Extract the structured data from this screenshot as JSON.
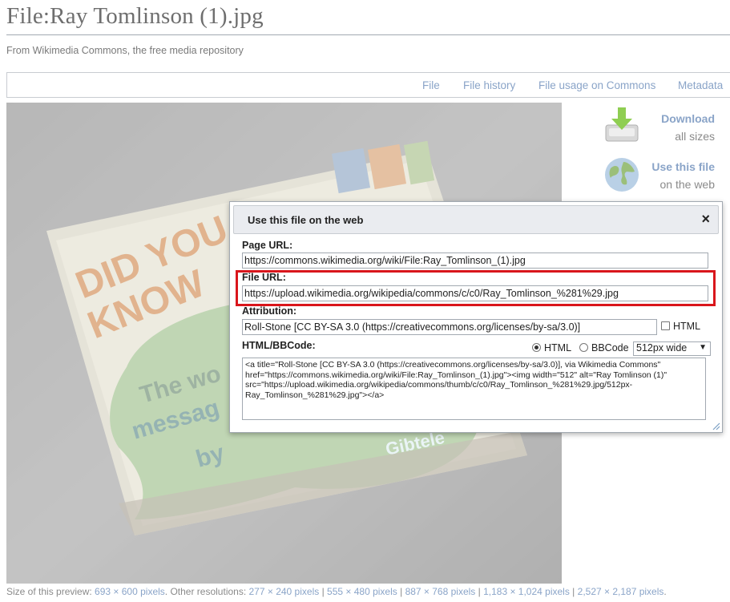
{
  "page": {
    "title": "File:Ray Tomlinson (1).jpg",
    "tagline": "From Wikimedia Commons, the free media repository"
  },
  "tabs": [
    {
      "label": "File"
    },
    {
      "label": "File history"
    },
    {
      "label": "File usage on Commons"
    },
    {
      "label": "Metadata"
    }
  ],
  "sidebar": {
    "download": {
      "label": "Download",
      "sub": "all sizes",
      "icon": "download-icon"
    },
    "use": {
      "label": "Use this file",
      "sub": "on the web",
      "icon": "globe-icon"
    }
  },
  "dialog": {
    "title": "Use this file on the web",
    "close": "×",
    "page_url_label": "Page URL:",
    "page_url": "https://commons.wikimedia.org/wiki/File:Ray_Tomlinson_(1).jpg",
    "file_url_label": "File URL:",
    "file_url": "https://upload.wikimedia.org/wikipedia/commons/c/c0/Ray_Tomlinson_%281%29.jpg",
    "attribution_label": "Attribution:",
    "attribution": "Roll-Stone [CC BY-SA 3.0 (https://creativecommons.org/licenses/by-sa/3.0)]",
    "attribution_html_label": "HTML",
    "code_label": "HTML/BBCode:",
    "radio_html": "HTML",
    "radio_bbcode": "BBCode",
    "size_select": "512px wide",
    "code": "<a title=\"Roll-Stone [CC BY-SA 3.0 (https://creativecommons.org/licenses/by-sa/3.0)], via Wikimedia Commons\" href=\"https://commons.wikimedia.org/wiki/File:Ray_Tomlinson_(1).jpg\"><img width=\"512\" alt=\"Ray Tomlinson (1)\" src=\"https://upload.wikimedia.org/wikipedia/commons/thumb/c/c0/Ray_Tomlinson_%281%29.jpg/512px-Ray_Tomlinson_%281%29.jpg\"></a>",
    "highlight_color": "#d9161c"
  },
  "preview_image": {
    "sign_text_1": "DID YOU",
    "sign_text_2": "KNOW",
    "sign_text_3": "The wo",
    "sign_text_4": "messag",
    "sign_text_5": "by",
    "sign_text_6": "Gibtele"
  },
  "footer": {
    "prefix": "Size of this preview: ",
    "preview_size": "693 × 600 pixels",
    "other": ". Other resolutions: ",
    "res1": "277 × 240 pixels",
    "sep": " | ",
    "res2": "555 × 480 pixels",
    "res3": "887 × 768 pixels",
    "res4": "1,183 × 1,024 pixels",
    "res5": "2,527 × 2,187 pixels",
    "end": "."
  },
  "colors": {
    "link": "#8aa4c8",
    "highlight": "#d9161c"
  }
}
